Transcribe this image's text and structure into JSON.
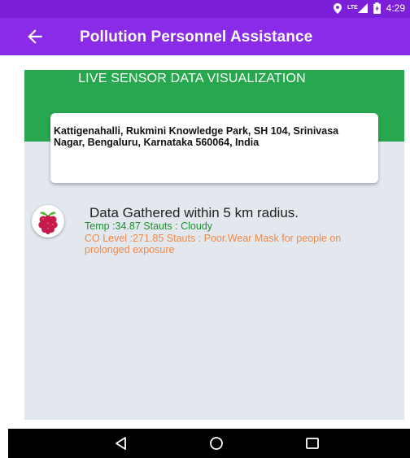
{
  "status_bar": {
    "time": "4:29",
    "network": "LTE"
  },
  "app_bar": {
    "title": "Pollution Personnel Assistance"
  },
  "header": {
    "title": "LIVE SENSOR DATA VISUALIZATION"
  },
  "location": {
    "address": "Kattigenahalli, Rukmini Knowledge Park, SH 104, Srinivasa Nagar, Bengaluru, Karnataka 560064, India"
  },
  "sensor": {
    "radius_text": "Data Gathered within 5 km radius.",
    "temp_text": "Temp :34.87  Stauts : Cloudy",
    "co_text": "CO Level :271.85  Stauts : Poor.Wear Mask for people on prolonged exposure"
  },
  "colors": {
    "app_bar": "#8a2be8",
    "header": "#28a84e",
    "temp": "#1f8f32",
    "co": "#f08a48"
  }
}
